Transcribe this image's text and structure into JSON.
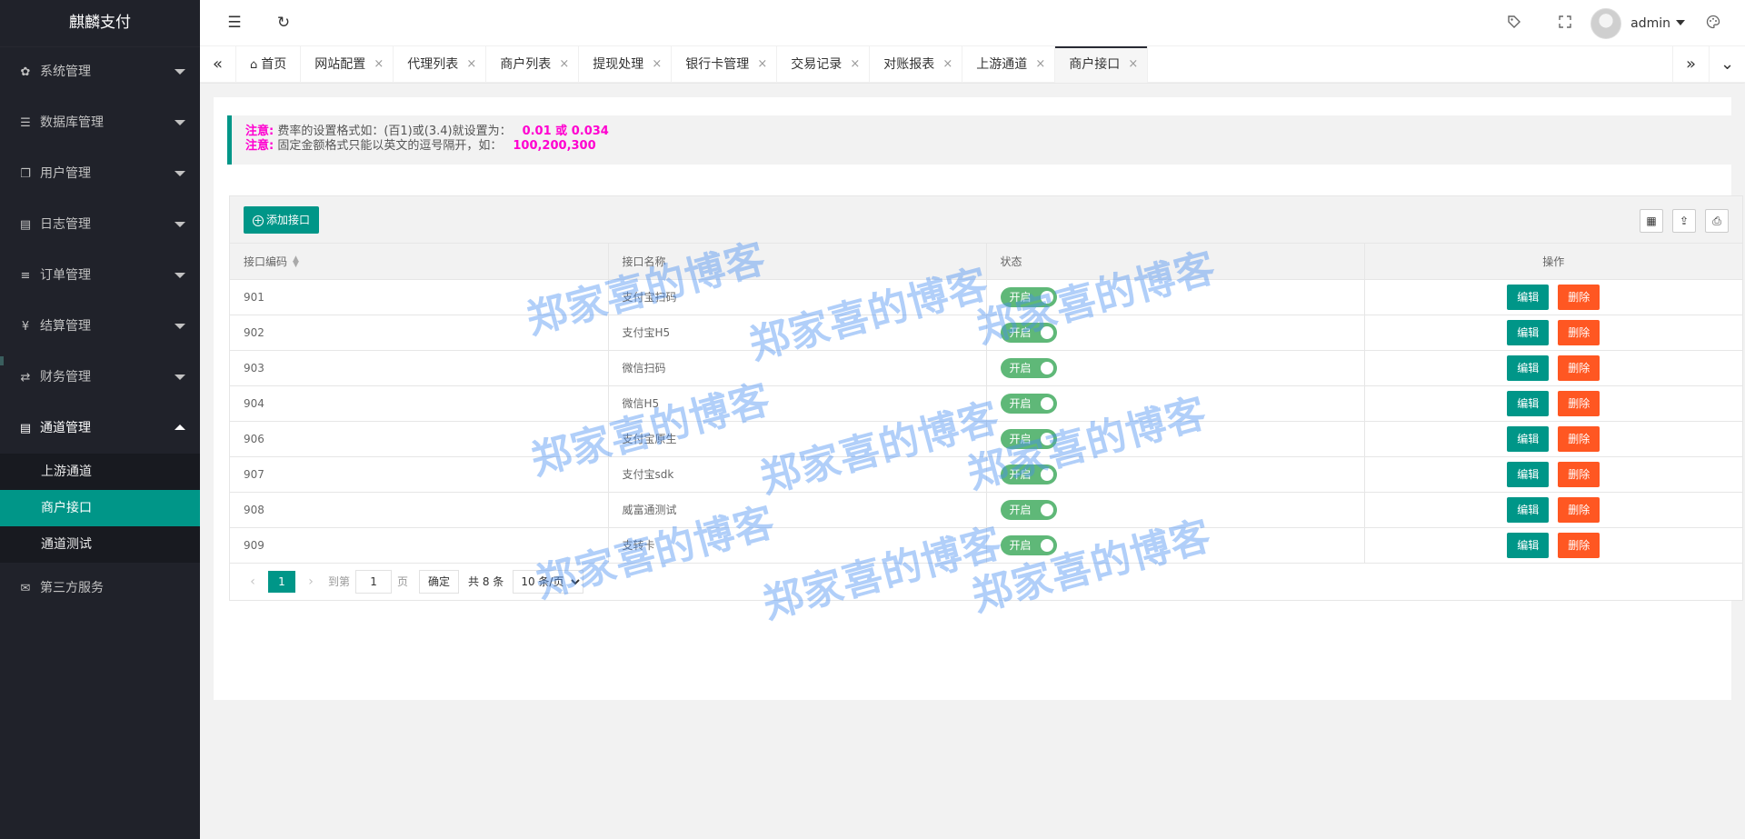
{
  "app": {
    "title": "麒麟支付"
  },
  "sidebar": {
    "items": [
      {
        "icon": "gear-icon",
        "glyph": "✿",
        "label": "系统管理"
      },
      {
        "icon": "database-icon",
        "glyph": "☰",
        "label": "数据库管理"
      },
      {
        "icon": "users-icon",
        "glyph": "❐",
        "label": "用户管理"
      },
      {
        "icon": "log-icon",
        "glyph": "▤",
        "label": "日志管理"
      },
      {
        "icon": "list-icon",
        "glyph": "≡",
        "label": "订单管理"
      },
      {
        "icon": "yen-icon",
        "glyph": "¥",
        "label": "结算管理"
      },
      {
        "icon": "exchange-icon",
        "glyph": "⇄",
        "label": "财务管理"
      },
      {
        "icon": "channel-icon",
        "glyph": "▤",
        "label": "通道管理"
      }
    ],
    "sub_items": [
      {
        "label": "上游通道"
      },
      {
        "label": "商户接口"
      },
      {
        "label": "通道测试"
      }
    ],
    "last_item": {
      "icon": "mail-icon",
      "glyph": "✉",
      "label": "第三方服务"
    }
  },
  "header": {
    "user": "admin",
    "menu_glyph": "☰",
    "refresh_glyph": "↻"
  },
  "tabs": {
    "items": [
      {
        "label": "首页"
      },
      {
        "label": "网站配置"
      },
      {
        "label": "代理列表"
      },
      {
        "label": "商户列表"
      },
      {
        "label": "提现处理"
      },
      {
        "label": "银行卡管理"
      },
      {
        "label": "交易记录"
      },
      {
        "label": "对账报表"
      },
      {
        "label": "上游通道"
      },
      {
        "label": "商户接口"
      }
    ],
    "close_glyph": "×"
  },
  "notice": {
    "line1_label": "注意:",
    "line1_text": "费率的设置格式如：(百1)或(3.4)就设置为：",
    "line1_value": "0.01 或 0.034",
    "line2_label": "注意:",
    "line2_text": "固定金额格式只能以英文的逗号隔开，如：",
    "line2_value": "100,200,300"
  },
  "table": {
    "add_label": "添加接口",
    "columns": [
      "接口编码",
      "接口名称",
      "状态",
      "操作"
    ],
    "rows": [
      {
        "code": "901",
        "name": "支付宝扫码",
        "status": "开启"
      },
      {
        "code": "902",
        "name": "支付宝H5",
        "status": "开启"
      },
      {
        "code": "903",
        "name": "微信扫码",
        "status": "开启"
      },
      {
        "code": "904",
        "name": "微信H5",
        "status": "开启"
      },
      {
        "code": "906",
        "name": "支付宝原生",
        "status": "开启"
      },
      {
        "code": "907",
        "name": "支付宝sdk",
        "status": "开启"
      },
      {
        "code": "908",
        "name": "威富通测试",
        "status": "开启"
      },
      {
        "code": "909",
        "name": "支转卡",
        "status": "开启"
      }
    ],
    "edit_label": "编辑",
    "delete_label": "删除"
  },
  "pager": {
    "current": "1",
    "goto_label": "到第",
    "goto_value": "1",
    "page_unit": "页",
    "confirm": "确定",
    "total": "共 8 条",
    "page_size": "10 条/页"
  },
  "watermark": {
    "text": "郑家喜的博客"
  },
  "colors": {
    "primary": "#009688",
    "danger": "#ff5722",
    "switch_on": "#5fb878",
    "sidebar": "#20222a",
    "notice_highlight": "#ff00d0"
  }
}
